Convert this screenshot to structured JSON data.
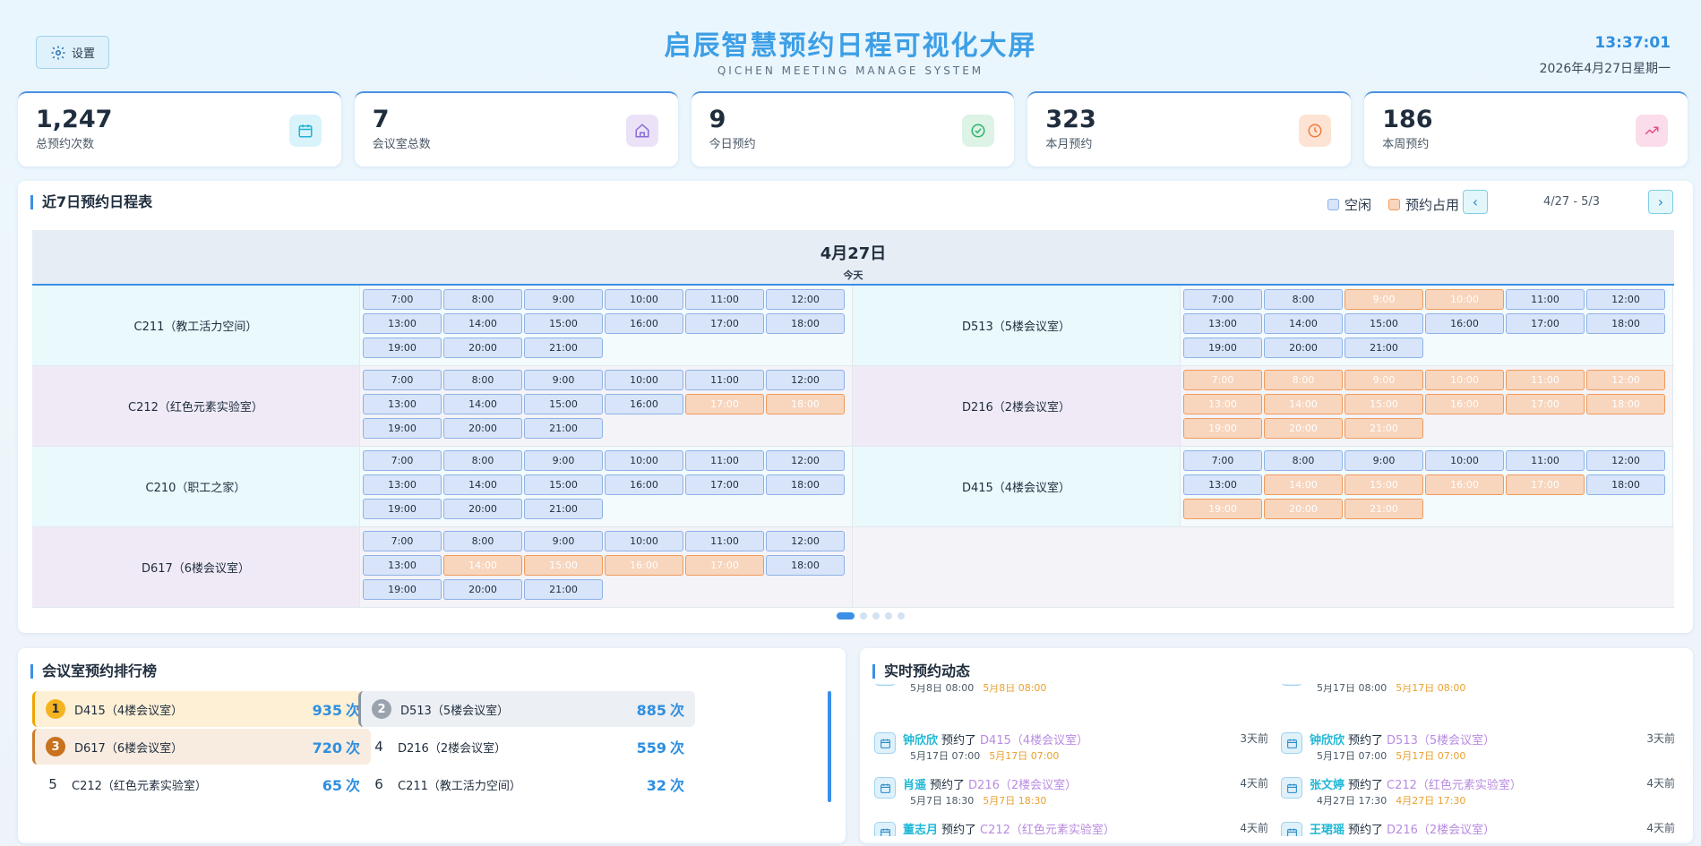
{
  "header": {
    "settings_label": "设置",
    "title": "启辰智慧预约日程可视化大屏",
    "subtitle": "QICHEN MEETING MANAGE SYSTEM",
    "time": "13:37:01",
    "date": "2026年4月27日星期一"
  },
  "stats": [
    {
      "value": "1,247",
      "label": "总预约次数",
      "icon": "calendar-icon",
      "color": "#1fb3d6",
      "bg": "#d9f3fa"
    },
    {
      "value": "7",
      "label": "会议室总数",
      "icon": "home-icon",
      "color": "#8b6bd6",
      "bg": "#ebe2f8"
    },
    {
      "value": "9",
      "label": "今日预约",
      "icon": "check-circle-icon",
      "color": "#2db36b",
      "bg": "#dcf3e6"
    },
    {
      "value": "323",
      "label": "本月预约",
      "icon": "clock-icon",
      "color": "#ef7a3a",
      "bg": "#fde3d4"
    },
    {
      "value": "186",
      "label": "本周预约",
      "icon": "trend-up-icon",
      "color": "#e24d8c",
      "bg": "#fbdcea"
    }
  ],
  "schedule": {
    "title": "近7日预约日程表",
    "legend_free": "空闲",
    "legend_busy": "预约占用",
    "range": "4/27 - 5/3",
    "day": "4月27日",
    "day_sub": "今天",
    "rows": [
      {
        "left": {
          "name": "C211（教工活力空间）",
          "busy": []
        },
        "right": {
          "name": "D513（5楼会议室）",
          "busy": [
            "9:00",
            "10:00"
          ]
        },
        "tone": "c"
      },
      {
        "left": {
          "name": "C212（红色元素实验室）",
          "busy": [
            "17:00",
            "18:00"
          ]
        },
        "right": {
          "name": "D216（2楼会议室）",
          "busy": [
            "7:00",
            "8:00",
            "9:00",
            "10:00",
            "11:00",
            "12:00",
            "13:00",
            "14:00",
            "15:00",
            "16:00",
            "17:00",
            "18:00",
            "19:00",
            "20:00",
            "21:00"
          ]
        },
        "tone": "p"
      },
      {
        "left": {
          "name": "C210（职工之家）",
          "busy": []
        },
        "right": {
          "name": "D415（4楼会议室）",
          "busy": [
            "14:00",
            "15:00",
            "16:00",
            "17:00",
            "19:00",
            "20:00",
            "21:00"
          ]
        },
        "tone": "c"
      },
      {
        "left": {
          "name": "D617（6楼会议室）",
          "busy": [
            "14:00",
            "15:00",
            "16:00",
            "17:00"
          ]
        },
        "right": null,
        "tone": "p"
      }
    ],
    "slots": [
      "7:00",
      "8:00",
      "9:00",
      "10:00",
      "11:00",
      "12:00",
      "13:00",
      "14:00",
      "15:00",
      "16:00",
      "17:00",
      "18:00",
      "19:00",
      "20:00",
      "21:00"
    ]
  },
  "ranking": {
    "title": "会议室预约排行榜",
    "unit": "次",
    "items": [
      {
        "rank": "1",
        "name": "D415（4楼会议室）",
        "count": "935"
      },
      {
        "rank": "2",
        "name": "D513（5楼会议室）",
        "count": "885"
      },
      {
        "rank": "3",
        "name": "D617（6楼会议室）",
        "count": "720"
      },
      {
        "rank": "4",
        "name": "D216（2楼会议室）",
        "count": "559"
      },
      {
        "rank": "5",
        "name": "C212（红色元素实验室）",
        "count": "65"
      },
      {
        "rank": "6",
        "name": "C211（教工活力空间）",
        "count": "32"
      }
    ]
  },
  "feed": {
    "title": "实时预约动态",
    "verb": "预约了",
    "items": [
      {
        "user": "",
        "room": "",
        "time1": "5月8日 08:00",
        "time2": "5月8日 08:00",
        "ago": ""
      },
      {
        "user": "",
        "room": "",
        "time1": "5月17日 08:00",
        "time2": "5月17日 08:00",
        "ago": ""
      },
      {
        "user": "钟欣欣",
        "room": "D415（4楼会议室）",
        "time1": "5月17日 07:00",
        "time2": "5月17日 07:00",
        "ago": "3天前"
      },
      {
        "user": "钟欣欣",
        "room": "D513（5楼会议室）",
        "time1": "5月17日 07:00",
        "time2": "5月17日 07:00",
        "ago": "3天前"
      },
      {
        "user": "肖遥",
        "room": "D216（2楼会议室）",
        "time1": "5月7日 18:30",
        "time2": "5月7日 18:30",
        "ago": "4天前"
      },
      {
        "user": "张文婷",
        "room": "C212（红色元素实验室）",
        "time1": "4月27日 17:30",
        "time2": "4月27日 17:30",
        "ago": "4天前"
      },
      {
        "user": "董志月",
        "room": "C212（红色元素实验室）",
        "time1": "",
        "time2": "",
        "ago": "4天前"
      },
      {
        "user": "王珺瑶",
        "room": "D216（2楼会议室）",
        "time1": "",
        "time2": "",
        "ago": "4天前"
      }
    ]
  }
}
